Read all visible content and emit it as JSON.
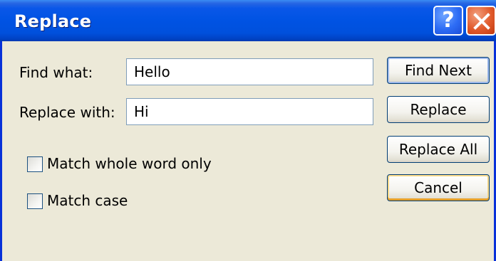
{
  "window": {
    "title": "Replace",
    "help_label": "?",
    "close_icon": "close-icon"
  },
  "find": {
    "label": "Find what:",
    "value": "Hello"
  },
  "replace": {
    "label": "Replace with:",
    "value": "Hi"
  },
  "options": {
    "whole_word": {
      "label": "Match whole word only",
      "checked": false
    },
    "match_case": {
      "label": "Match case",
      "checked": false
    }
  },
  "buttons": {
    "find_next": "Find Next",
    "replace": "Replace",
    "replace_all": "Replace All",
    "cancel": "Cancel"
  },
  "colors": {
    "titlebar": "#0053E3",
    "dialog_bg": "#ECE9D8",
    "close_button": "#E15A2B"
  }
}
